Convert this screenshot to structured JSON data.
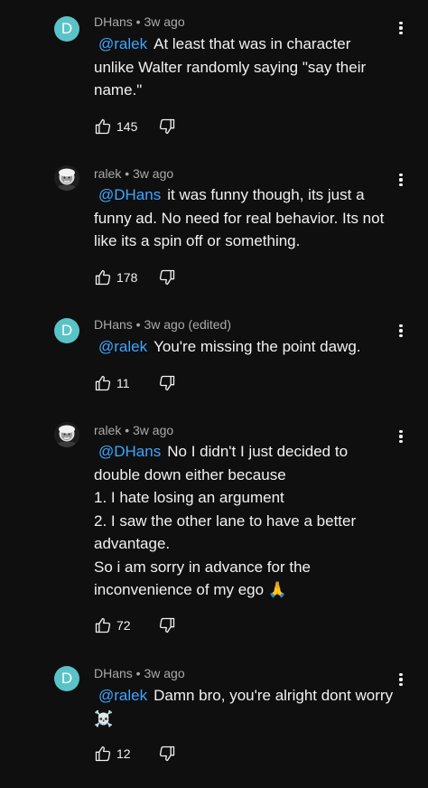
{
  "comments": [
    {
      "author": "DHans",
      "avatar_letter": "D",
      "avatar_type": "letter",
      "meta": "DHans • 3w ago",
      "mention": "@ralek",
      "lines": [
        "At least that was in character",
        "unlike Walter randomly saying \"say their",
        "name.\""
      ],
      "likes": "145"
    },
    {
      "author": "ralek",
      "avatar_type": "photo",
      "meta": "ralek • 3w ago",
      "mention": "@DHans",
      "lines": [
        "it was funny though, its just a",
        "funny ad. No need for real behavior. Its not",
        "like its a spin off or something."
      ],
      "likes": "178"
    },
    {
      "author": "DHans",
      "avatar_letter": "D",
      "avatar_type": "letter",
      "meta": "DHans • 3w ago (edited)",
      "mention": "@ralek",
      "lines": [
        "You're missing the point dawg."
      ],
      "likes": "11"
    },
    {
      "author": "ralek",
      "avatar_type": "photo",
      "meta": "ralek • 3w ago",
      "mention": "@DHans",
      "lines": [
        "No I didn't I just decided to",
        "double down either because",
        "1. I hate losing an argument",
        "2. I saw the other lane to have a better",
        "advantage.",
        "So i am sorry in advance for the",
        "inconvenience of my ego 🙏"
      ],
      "likes": "72"
    },
    {
      "author": "DHans",
      "avatar_letter": "D",
      "avatar_type": "letter",
      "meta": "DHans • 3w ago",
      "mention": "@ralek",
      "lines": [
        "Damn bro, you're alright dont worry",
        "☠️"
      ],
      "likes": "12"
    }
  ],
  "colors": {
    "background": "#0f0f0f",
    "text": "#f1f1f1",
    "meta": "#aaaaaa",
    "mention": "#3ea6ff",
    "avatar_letter_bg": "#5ac3c8"
  },
  "icons": {
    "like": "thumbs-up-icon",
    "dislike": "thumbs-down-icon",
    "more": "more-vertical-icon"
  }
}
